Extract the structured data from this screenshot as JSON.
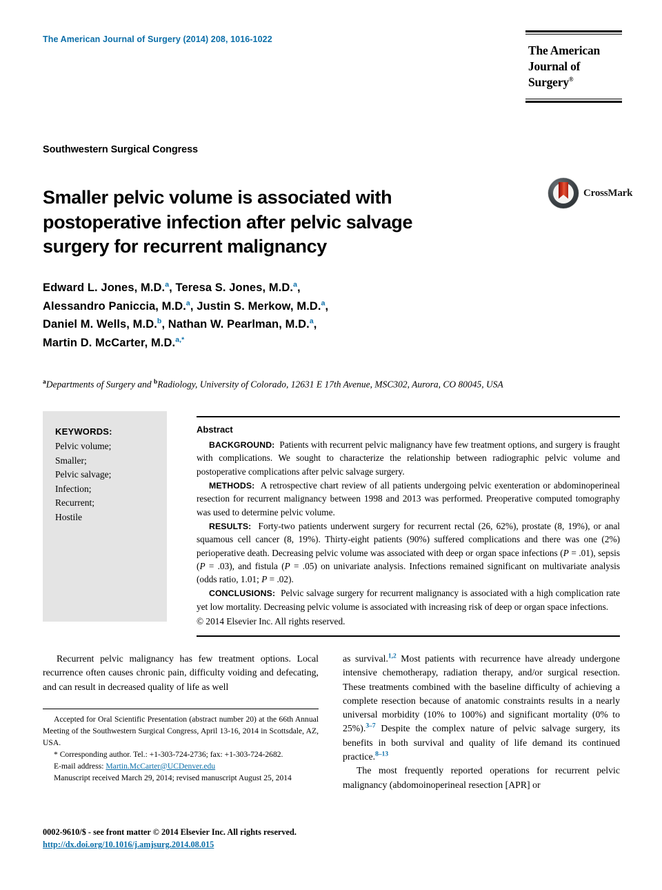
{
  "masthead": {
    "journal_ref": "The American Journal of Surgery (2014) 208, 1016-1022",
    "logo_line1": "The American",
    "logo_line2": "Journal of Surgery",
    "logo_trademark": "®"
  },
  "crossmark": {
    "label": "CrossMark",
    "icon": "crossmark-logo"
  },
  "society": "Southwestern Surgical Congress",
  "title": "Smaller pelvic volume is associated with postoperative infection after pelvic salvage surgery for recurrent malignancy",
  "authors": {
    "line1_a": "Edward L. Jones, M.D.",
    "line1_sup1": "a",
    "line1_b": ", Teresa S. Jones, M.D.",
    "line1_sup2": "a",
    "line1_c": ",",
    "line2_a": "Alessandro Paniccia, M.D.",
    "line2_sup1": "a",
    "line2_b": ", Justin S. Merkow, M.D.",
    "line2_sup2": "a",
    "line2_c": ",",
    "line3_a": "Daniel M. Wells, M.D.",
    "line3_sup1": "b",
    "line3_b": ", Nathan W. Pearlman, M.D.",
    "line3_sup2": "a",
    "line3_c": ",",
    "line4_a": "Martin D. McCarter, M.D.",
    "line4_sup1": "a,",
    "line4_star": "*"
  },
  "affiliation": {
    "sup_a": "a",
    "text_1": "Departments of Surgery and ",
    "sup_b": "b",
    "text_2": "Radiology, University of Colorado, 12631 E 17th Avenue, MSC302, Aurora, CO 80045, USA"
  },
  "keywords": {
    "heading": "KEYWORDS:",
    "items": [
      "Pelvic volume;",
      "Smaller;",
      "Pelvic salvage;",
      "Infection;",
      "Recurrent;",
      "Hostile"
    ]
  },
  "abstract": {
    "heading": "Abstract",
    "sections": [
      {
        "label": "BACKGROUND:",
        "text": "Patients with recurrent pelvic malignancy have few treatment options, and surgery is fraught with complications. We sought to characterize the relationship between radiographic pelvic volume and postoperative complications after pelvic salvage surgery."
      },
      {
        "label": "METHODS:",
        "text": "A retrospective chart review of all patients undergoing pelvic exenteration or abdominoperineal resection for recurrent malignancy between 1998 and 2013 was performed. Preoperative computed tomography was used to determine pelvic volume."
      },
      {
        "label": "RESULTS:",
        "text": "Forty-two patients underwent surgery for recurrent rectal (26, 62%), prostate (8, 19%), or anal squamous cell cancer (8, 19%). Thirty-eight patients (90%) suffered complications and there was one (2%) perioperative death. Decreasing pelvic volume was associated with deep or organ space infections (P = .01), sepsis (P = .03), and fistula (P = .05) on univariate analysis. Infections remained significant on multivariate analysis (odds ratio, 1.01; P = .02)."
      },
      {
        "label": "CONCLUSIONS:",
        "text": "Pelvic salvage surgery for recurrent malignancy is associated with a high complication rate yet low mortality. Decreasing pelvic volume is associated with increasing risk of deep or organ space infections."
      }
    ],
    "copyright": "© 2014 Elsevier Inc. All rights reserved."
  },
  "body": {
    "left_paragraph": "Recurrent pelvic malignancy has few treatment options. Local recurrence often causes chronic pain, difficulty voiding and defecating, and can result in decreased quality of life as well",
    "right_p1_pre": "as survival.",
    "right_p1_ref1": "1,2",
    "right_p1_mid": " Most patients with recurrence have already undergone intensive chemotherapy, radiation therapy, and/or surgical resection. These treatments combined with the baseline difficulty of achieving a complete resection because of anatomic constraints results in a nearly universal morbidity (10% to 100%) and significant mortality (0% to 25%).",
    "right_p1_ref2": "3–7",
    "right_p1_post": " Despite the complex nature of pelvic salvage surgery, its benefits in both survival and quality of life demand its continued practice.",
    "right_p1_ref3": "8–13",
    "right_p2": "The most frequently reported operations for recurrent pelvic malignancy (abdomoinoperineal resection [APR] or"
  },
  "footnotes": {
    "accepted": "Accepted for Oral Scientific Presentation (abstract number 20) at the 66th Annual Meeting of the Southwestern Surgical Congress, April 13-16, 2014 in Scottsdale, AZ, USA.",
    "corresponding_star": "*",
    "corresponding": " Corresponding author. Tel.: +1-303-724-2736; fax: +1-303-724-2682.",
    "email_label": "E-mail address:",
    "email_value": "Martin.McCarter@UCDenver.edu",
    "manuscript": "Manuscript received March 29, 2014; revised manuscript August 25, 2014"
  },
  "footer": {
    "issn_line": "0002-9610/$ - see front matter © 2014 Elsevier Inc. All rights reserved.",
    "doi": "http://dx.doi.org/10.1016/j.amjsurg.2014.08.015"
  },
  "colors": {
    "accent_blue": "#0b6ea8",
    "keywords_bg": "#e4e4e4",
    "crossmark_red": "#d2331c"
  }
}
